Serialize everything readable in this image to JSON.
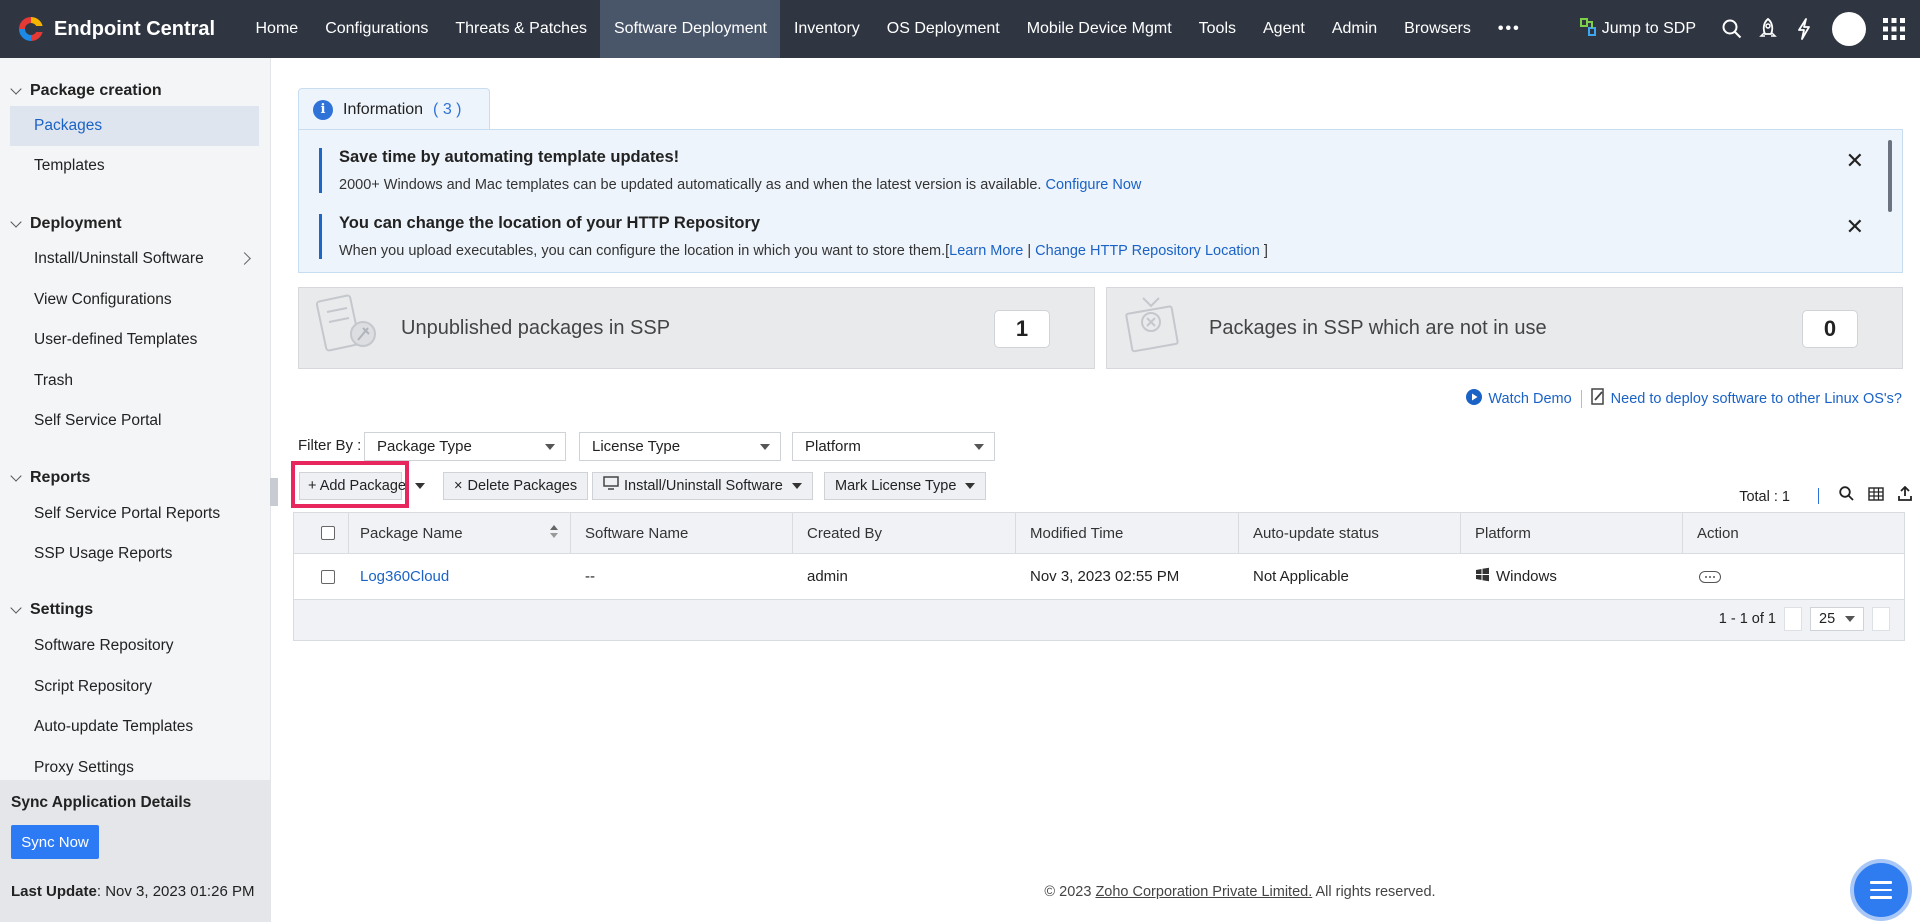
{
  "app": {
    "title": "Endpoint Central"
  },
  "nav": {
    "items": [
      "Home",
      "Configurations",
      "Threats & Patches",
      "Software Deployment",
      "Inventory",
      "OS Deployment",
      "Mobile Device Mgmt",
      "Tools",
      "Agent",
      "Admin",
      "Browsers"
    ],
    "active": "Software Deployment",
    "more": "•••",
    "jump_label": "Jump to SDP"
  },
  "sidebar": {
    "groups": [
      {
        "title": "Package creation",
        "items": [
          "Packages",
          "Templates"
        ]
      },
      {
        "title": "Deployment",
        "items": [
          "Install/Uninstall Software",
          "View Configurations",
          "User-defined Templates",
          "Trash",
          "Self Service Portal"
        ]
      },
      {
        "title": "Reports",
        "items": [
          "Self Service Portal Reports",
          "SSP Usage Reports"
        ]
      },
      {
        "title": "Settings",
        "items": [
          "Software Repository",
          "Script Repository",
          "Auto-update Templates",
          "Proxy Settings"
        ]
      }
    ],
    "active_item": "Packages",
    "sync": {
      "title": "Sync Application Details",
      "button": "Sync Now",
      "last_update_label": "Last Update",
      "last_update_value": ": Nov 3, 2023 01:26 PM"
    }
  },
  "info": {
    "tab_label": "Information",
    "count": "( 3 )",
    "notices": [
      {
        "title": "Save time by automating template updates!",
        "text": "2000+ Windows and Mac templates can be updated automatically as and when the latest version is available.",
        "link": "Configure Now"
      },
      {
        "title": "You can change the location of your HTTP Repository",
        "text": "When you upload executables, you can configure the location in which you want to store them.[",
        "link1": "Learn More",
        "divider": "|",
        "link2": "Change HTTP Repository Location",
        "suffix": "]"
      }
    ]
  },
  "stats": [
    {
      "label": "Unpublished packages in SSP",
      "value": "1"
    },
    {
      "label": "Packages in SSP which are not in use",
      "value": "0"
    }
  ],
  "helpers": {
    "watch_demo": "Watch Demo",
    "linux_link": "Need to deploy software to other Linux OS's?"
  },
  "filters": {
    "label": "Filter By :",
    "selects": [
      "Package Type",
      "License Type",
      "Platform"
    ]
  },
  "toolbar": {
    "add_package": "+ Add Package",
    "delete_packages": "Delete Packages",
    "install_uninstall": "Install/Uninstall Software",
    "mark_license": "Mark License Type",
    "total": "Total : 1"
  },
  "table": {
    "columns": [
      "Package Name",
      "Software Name",
      "Created By",
      "Modified Time",
      "Auto-update status",
      "Platform",
      "Action"
    ],
    "rows": [
      {
        "package_name": "Log360Cloud",
        "software_name": "--",
        "created_by": "admin",
        "modified_time": "Nov 3, 2023 02:55 PM",
        "auto_update": "Not Applicable",
        "platform": "Windows"
      }
    ],
    "pagination": {
      "range": "1 - 1 of 1",
      "page_size": "25"
    }
  },
  "footer": {
    "prefix": "© 2023",
    "company": "Zoho Corporation Private Limited.",
    "suffix": "All rights reserved."
  },
  "colors": {
    "topbar": "#2f3641",
    "accent": "#1a62c6",
    "highlight": "#e8265e"
  }
}
